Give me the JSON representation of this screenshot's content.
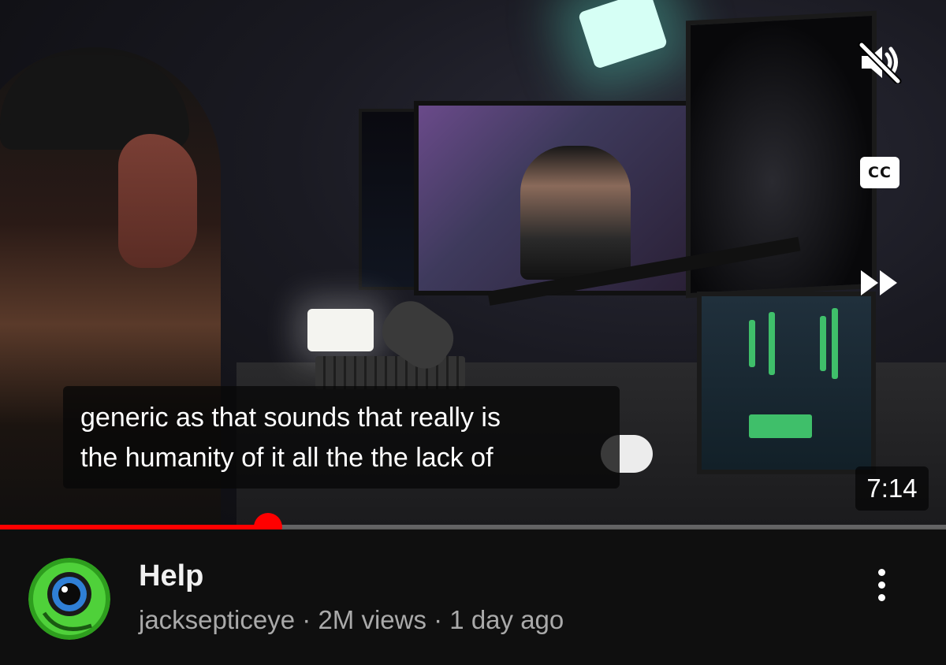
{
  "player": {
    "captions": [
      "generic as that sounds that really is",
      "the humanity of it all the the lack of"
    ],
    "duration": "7:14",
    "progress_fraction": 0.283,
    "cc_label": "CC",
    "muted": true
  },
  "video": {
    "title": "Help",
    "channel": "jacksepticeye",
    "views": "2M views",
    "age": "1 day ago",
    "separator": " · "
  },
  "colors": {
    "progress": "#ff0000",
    "background": "#0f0f0f",
    "meta_text": "#aaaaaa"
  },
  "icons": {
    "mute": "volume-muted-icon",
    "captions": "closed-captions-icon",
    "forward": "fast-forward-icon",
    "more": "more-vertical-icon",
    "avatar": "septiceye-logo"
  }
}
